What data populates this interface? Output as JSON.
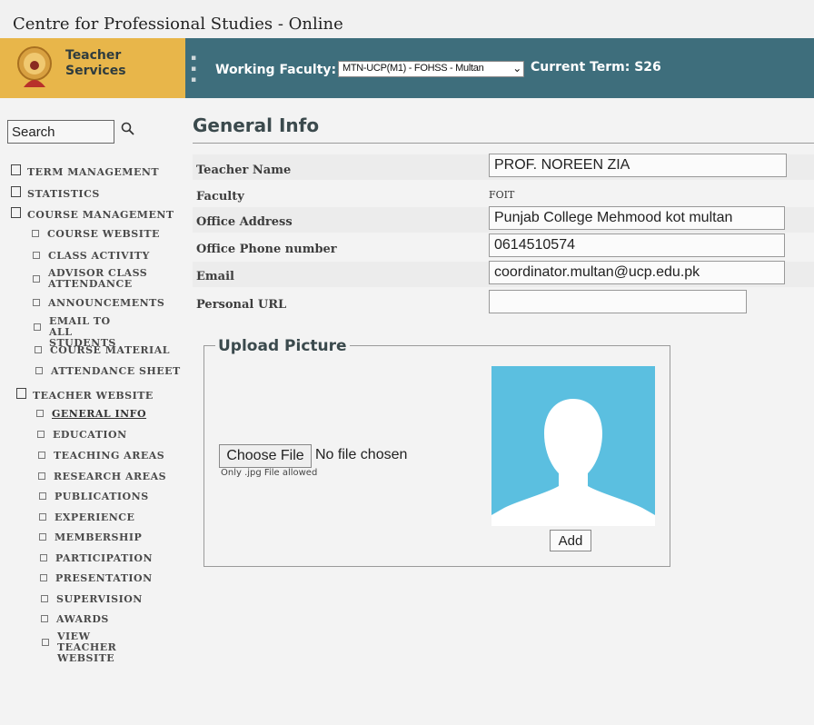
{
  "window": {
    "title": "Centre for Professional Studies - Online"
  },
  "brand": {
    "line1": "Teacher",
    "line2": "Services"
  },
  "header": {
    "faculty_label": "Working Faculty:",
    "faculty_value": "MTN-UCP(M1) - FOHSS - Multan",
    "term_label": "Current Term: S26"
  },
  "search": {
    "value": "Search"
  },
  "nav": [
    {
      "label": "TERM MANAGEMENT",
      "level": 0
    },
    {
      "label": "STATISTICS",
      "level": 0
    },
    {
      "label": "COURSE MANAGEMENT",
      "level": 0
    },
    {
      "label": "COURSE WEBSITE",
      "level": 1
    },
    {
      "label": "CLASS ACTIVITY",
      "level": 1
    },
    {
      "label": "ADVISOR CLASS ATTENDANCE",
      "level": 1
    },
    {
      "label": "ANNOUNCEMENTS",
      "level": 1
    },
    {
      "label": "EMAIL TO ALL STUDENTS",
      "level": 1
    },
    {
      "label": "COURSE MATERIAL",
      "level": 1
    },
    {
      "label": "ATTENDANCE SHEET",
      "level": 1
    },
    {
      "label": "TEACHER WEBSITE",
      "level": 0
    },
    {
      "label": "GENERAL INFO",
      "level": 1,
      "active": true
    },
    {
      "label": "EDUCATION",
      "level": 1
    },
    {
      "label": "TEACHING AREAS",
      "level": 1
    },
    {
      "label": "RESEARCH AREAS",
      "level": 1
    },
    {
      "label": "PUBLICATIONS",
      "level": 1
    },
    {
      "label": "EXPERIENCE",
      "level": 1
    },
    {
      "label": "MEMBERSHIP",
      "level": 1
    },
    {
      "label": "PARTICIPATION",
      "level": 1
    },
    {
      "label": "PRESENTATION",
      "level": 1
    },
    {
      "label": "SUPERVISION",
      "level": 1
    },
    {
      "label": "AWARDS",
      "level": 1
    },
    {
      "label": "VIEW TEACHER WEBSITE",
      "level": 1
    }
  ],
  "main": {
    "title": "General Info",
    "fields": {
      "teacher_name": {
        "label": "Teacher Name",
        "value": "PROF. NOREEN ZIA"
      },
      "faculty": {
        "label": "Faculty",
        "value": "FOIT"
      },
      "office_address": {
        "label": "Office Address",
        "value": "Punjab College Mehmood kot multan"
      },
      "office_phone": {
        "label": "Office Phone number",
        "value": "0614510574"
      },
      "email": {
        "label": "Email",
        "value": "coordinator.multan@ucp.edu.pk"
      },
      "personal_url": {
        "label": "Personal URL",
        "value": ""
      }
    },
    "upload": {
      "legend": "Upload Picture",
      "choose_label": "Choose File",
      "no_file": "No file chosen",
      "hint": "Only .jpg File allowed",
      "add_label": "Add"
    }
  },
  "colors": {
    "brand_bg": "#e8b64a",
    "header_bg": "#3e6e7c",
    "photo_bg": "#5bbfe0"
  },
  "icons": {
    "search": "search-icon",
    "logo": "logo-icon",
    "avatar": "avatar-placeholder"
  }
}
